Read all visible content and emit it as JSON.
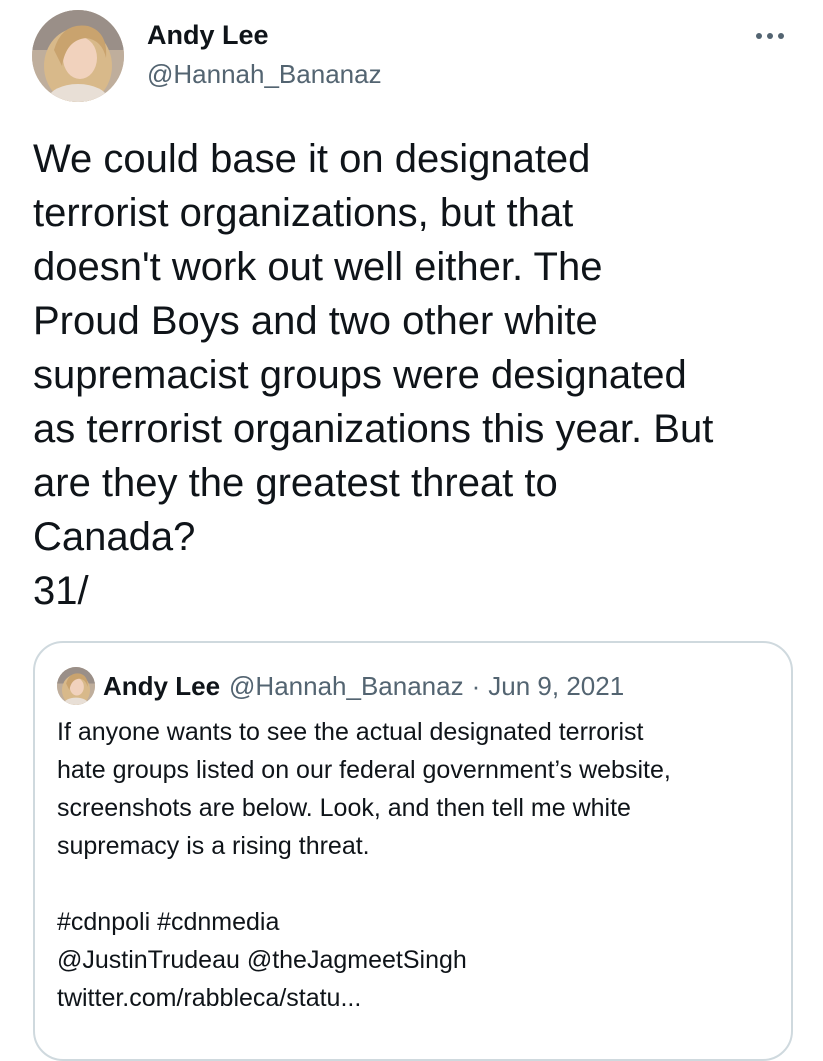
{
  "tweet": {
    "author": {
      "display_name": "Andy Lee",
      "handle": "@Hannah_Bananaz"
    },
    "more_icon": "more-horizontal-icon",
    "text": "We could base it on designated\nterrorist organizations, but that\ndoesn't work out well either. The\nProud Boys and two other white\nsupremacist groups were designated\nas terrorist organizations this year. But\nare they the greatest threat to\nCanada?\n31/"
  },
  "quote": {
    "author": {
      "display_name": "Andy Lee",
      "handle": "@Hannah_Bananaz"
    },
    "separator": "·",
    "date": "Jun 9, 2021",
    "lines": [
      "If anyone wants to see the actual designated terrorist",
      "hate groups listed on our federal government’s website,",
      "screenshots are below. Look, and then tell me white",
      "supremacy is a rising threat.",
      "#cdnpoli #cdnmedia",
      "@JustinTrudeau @theJagmeetSingh",
      "twitter.com/rabbleca/statu..."
    ]
  },
  "colors": {
    "text_primary": "#0f1419",
    "text_secondary": "#536471",
    "border": "#cfd9de"
  }
}
